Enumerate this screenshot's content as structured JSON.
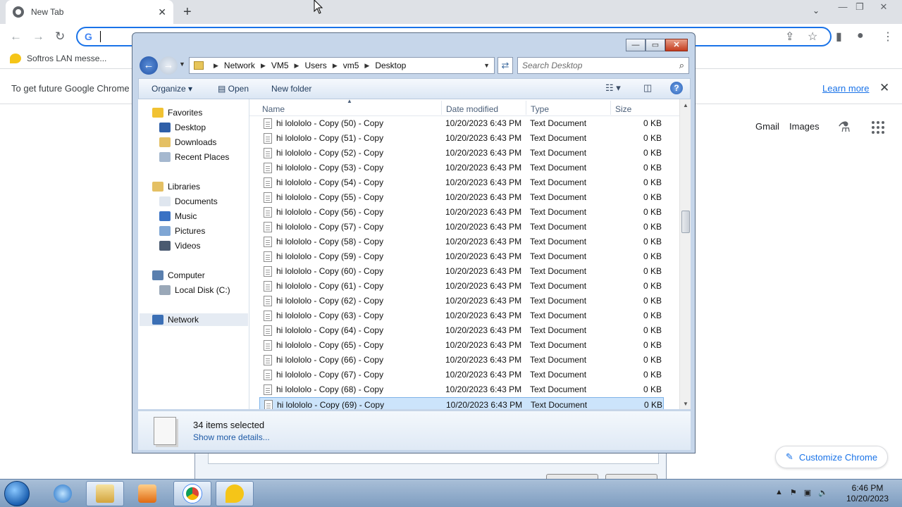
{
  "chrome": {
    "tab_title": "New Tab",
    "bookmark": "Softros LAN messe...",
    "infobar_message": "To get future Google Chrome",
    "learn_more": "Learn more",
    "ntp_links": {
      "gmail": "Gmail",
      "images": "Images"
    },
    "customize": "Customize Chrome",
    "omnibox_value": ""
  },
  "dialog": {
    "breadcrumb": [
      "Network",
      "VM5",
      "Users",
      "vm5",
      "Desktop"
    ],
    "search_placeholder": "Search Desktop",
    "commands": {
      "organize": "Organize",
      "open": "Open",
      "new_folder": "New folder"
    },
    "nav": {
      "favorites": "Favorites",
      "desktop": "Desktop",
      "downloads": "Downloads",
      "recent": "Recent Places",
      "libraries": "Libraries",
      "documents": "Documents",
      "music": "Music",
      "pictures": "Pictures",
      "videos": "Videos",
      "computer": "Computer",
      "local_disk": "Local Disk (C:)",
      "network": "Network"
    },
    "columns": {
      "name": "Name",
      "date": "Date modified",
      "type": "Type",
      "size": "Size"
    },
    "files": [
      {
        "name": "hi lolololo - Copy (50) - Copy",
        "date": "10/20/2023 6:43 PM",
        "type": "Text Document",
        "size": "0 KB"
      },
      {
        "name": "hi lolololo - Copy (51) - Copy",
        "date": "10/20/2023 6:43 PM",
        "type": "Text Document",
        "size": "0 KB"
      },
      {
        "name": "hi lolololo - Copy (52) - Copy",
        "date": "10/20/2023 6:43 PM",
        "type": "Text Document",
        "size": "0 KB"
      },
      {
        "name": "hi lolololo - Copy (53) - Copy",
        "date": "10/20/2023 6:43 PM",
        "type": "Text Document",
        "size": "0 KB"
      },
      {
        "name": "hi lolololo - Copy (54) - Copy",
        "date": "10/20/2023 6:43 PM",
        "type": "Text Document",
        "size": "0 KB"
      },
      {
        "name": "hi lolololo - Copy (55) - Copy",
        "date": "10/20/2023 6:43 PM",
        "type": "Text Document",
        "size": "0 KB"
      },
      {
        "name": "hi lolololo - Copy (56) - Copy",
        "date": "10/20/2023 6:43 PM",
        "type": "Text Document",
        "size": "0 KB"
      },
      {
        "name": "hi lolololo - Copy (57) - Copy",
        "date": "10/20/2023 6:43 PM",
        "type": "Text Document",
        "size": "0 KB"
      },
      {
        "name": "hi lolololo - Copy (58) - Copy",
        "date": "10/20/2023 6:43 PM",
        "type": "Text Document",
        "size": "0 KB"
      },
      {
        "name": "hi lolololo - Copy (59) - Copy",
        "date": "10/20/2023 6:43 PM",
        "type": "Text Document",
        "size": "0 KB"
      },
      {
        "name": "hi lolololo - Copy (60) - Copy",
        "date": "10/20/2023 6:43 PM",
        "type": "Text Document",
        "size": "0 KB"
      },
      {
        "name": "hi lolololo - Copy (61) - Copy",
        "date": "10/20/2023 6:43 PM",
        "type": "Text Document",
        "size": "0 KB"
      },
      {
        "name": "hi lolololo - Copy (62) - Copy",
        "date": "10/20/2023 6:43 PM",
        "type": "Text Document",
        "size": "0 KB"
      },
      {
        "name": "hi lolololo - Copy (63) - Copy",
        "date": "10/20/2023 6:43 PM",
        "type": "Text Document",
        "size": "0 KB"
      },
      {
        "name": "hi lolololo - Copy (64) - Copy",
        "date": "10/20/2023 6:43 PM",
        "type": "Text Document",
        "size": "0 KB"
      },
      {
        "name": "hi lolololo - Copy (65) - Copy",
        "date": "10/20/2023 6:43 PM",
        "type": "Text Document",
        "size": "0 KB"
      },
      {
        "name": "hi lolololo - Copy (66) - Copy",
        "date": "10/20/2023 6:43 PM",
        "type": "Text Document",
        "size": "0 KB"
      },
      {
        "name": "hi lolololo - Copy (67) - Copy",
        "date": "10/20/2023 6:43 PM",
        "type": "Text Document",
        "size": "0 KB"
      },
      {
        "name": "hi lolololo - Copy (68) - Copy",
        "date": "10/20/2023 6:43 PM",
        "type": "Text Document",
        "size": "0 KB"
      },
      {
        "name": "hi lolololo - Copy (69) - Copy",
        "date": "10/20/2023 6:43 PM",
        "type": "Text Document",
        "size": "0 KB",
        "selected": true
      }
    ],
    "status": {
      "count": "34 items selected",
      "more": "Show more details..."
    }
  },
  "taskbar": {
    "time": "6:46 PM",
    "date": "10/20/2023"
  },
  "colors": {
    "chrome_accent": "#1a73e8",
    "selection": "#cce4fb",
    "taskbar": "#8fa9c9"
  },
  "icons": {
    "tab_favicon": "chrome-icon",
    "back": "back-arrow-icon",
    "file": "text-document-icon",
    "labs": "flask-icon",
    "apps": "apps-grid-icon"
  }
}
